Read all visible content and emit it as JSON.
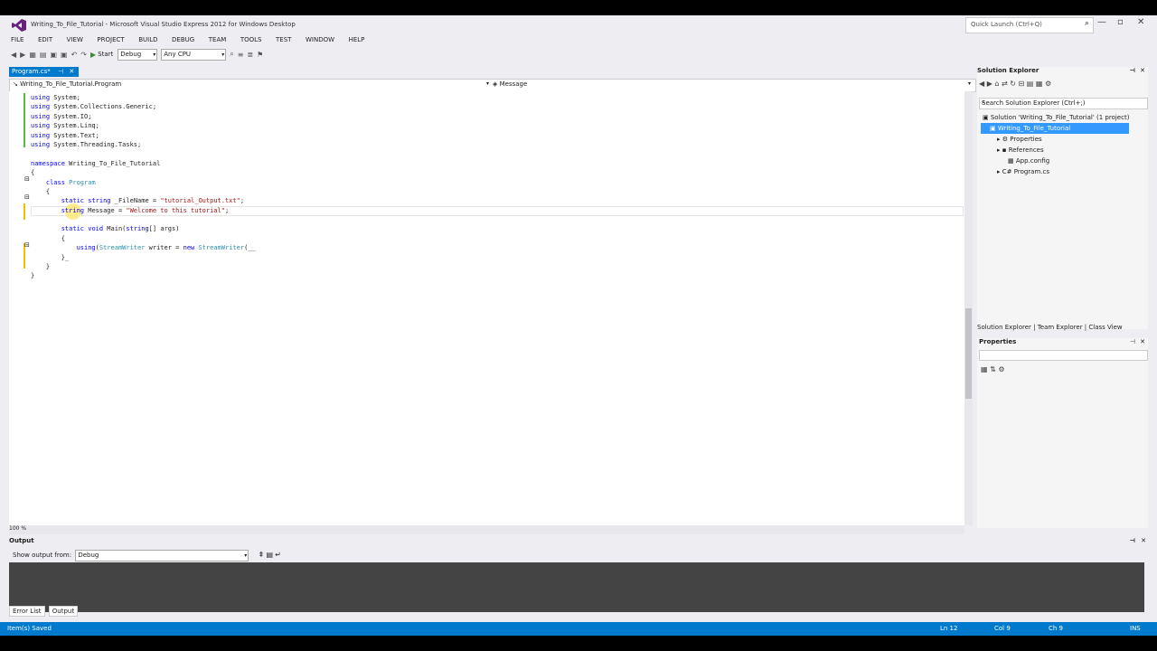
{
  "window": {
    "title": "Writing_To_File_Tutorial - Microsoft Visual Studio Express 2012 for Windows Desktop",
    "quick_launch_placeholder": "Quick Launch (Ctrl+Q)"
  },
  "menu": [
    "FILE",
    "EDIT",
    "VIEW",
    "PROJECT",
    "BUILD",
    "DEBUG",
    "TEAM",
    "TOOLS",
    "TEST",
    "WINDOW",
    "HELP"
  ],
  "toolbar": {
    "start_label": "Start",
    "config_value": "Debug",
    "platform_value": "Any CPU"
  },
  "doc_tab": {
    "label": "Program.cs*"
  },
  "navbar": {
    "left": "Writing_To_File_Tutorial.Program",
    "right": "Message"
  },
  "editor": {
    "lines": [
      [
        {
          "t": "using",
          "c": "kw"
        },
        {
          "t": " System;"
        }
      ],
      [
        {
          "t": "using",
          "c": "kw"
        },
        {
          "t": " System.Collections.Generic;"
        }
      ],
      [
        {
          "t": "using",
          "c": "kw"
        },
        {
          "t": " System.IO;"
        }
      ],
      [
        {
          "t": "using",
          "c": "kw"
        },
        {
          "t": " System.Linq;"
        }
      ],
      [
        {
          "t": "using",
          "c": "kw"
        },
        {
          "t": " System.Text;"
        }
      ],
      [
        {
          "t": "using",
          "c": "kw"
        },
        {
          "t": " System.Threading.Tasks;"
        }
      ],
      [],
      [
        {
          "t": "namespace",
          "c": "kw"
        },
        {
          "t": " Writing_To_File_Tutorial"
        }
      ],
      [
        {
          "t": "{"
        }
      ],
      [
        {
          "t": "    "
        },
        {
          "t": "class",
          "c": "kw"
        },
        {
          "t": " "
        },
        {
          "t": "Program",
          "c": "ty"
        }
      ],
      [
        {
          "t": "    {"
        }
      ],
      [
        {
          "t": "        "
        },
        {
          "t": "static",
          "c": "kw"
        },
        {
          "t": " "
        },
        {
          "t": "string",
          "c": "kw"
        },
        {
          "t": " _FileName = "
        },
        {
          "t": "\"tutorial_Output.txt\"",
          "c": "st"
        },
        {
          "t": ";"
        }
      ],
      [
        {
          "t": "        "
        },
        {
          "t": "string",
          "c": "kw"
        },
        {
          "t": " Message = "
        },
        {
          "t": "\"Welcome to this tutorial\"",
          "c": "st"
        },
        {
          "t": ";"
        }
      ],
      [],
      [
        {
          "t": "        "
        },
        {
          "t": "static",
          "c": "kw"
        },
        {
          "t": " "
        },
        {
          "t": "void",
          "c": "kw"
        },
        {
          "t": " Main("
        },
        {
          "t": "string",
          "c": "kw"
        },
        {
          "t": "[] args)"
        }
      ],
      [
        {
          "t": "        {"
        }
      ],
      [
        {
          "t": "            "
        },
        {
          "t": "using",
          "c": "kw"
        },
        {
          "t": "("
        },
        {
          "t": "StreamWriter",
          "c": "ty"
        },
        {
          "t": " writer = "
        },
        {
          "t": "new",
          "c": "kw"
        },
        {
          "t": " "
        },
        {
          "t": "StreamWriter",
          "c": "ty"
        },
        {
          "t": "(__"
        }
      ],
      [
        {
          "t": "        }_"
        }
      ],
      [
        {
          "t": "    }"
        }
      ],
      [
        {
          "t": "}"
        }
      ]
    ],
    "zoom": "100 %"
  },
  "solution_explorer": {
    "title": "Solution Explorer",
    "search_placeholder": "Search Solution Explorer (Ctrl+;)",
    "items": [
      "Solution 'Writing_To_File_Tutorial' (1 project)",
      "Writing_To_File_Tutorial",
      "Properties",
      "References",
      "App.config",
      "Program.cs"
    ]
  },
  "right_tabs": [
    "Solution Explorer",
    "Team Explorer",
    "Class View"
  ],
  "properties": {
    "title": "Properties"
  },
  "output": {
    "title": "Output",
    "source_label": "Show output from:",
    "source_value": "Debug"
  },
  "bottom_tabs": [
    "Error List",
    "Output"
  ],
  "status": {
    "message": "Item(s) Saved",
    "ln": "Ln 12",
    "col": "Col 9",
    "ch": "Ch 9",
    "mode": "INS"
  },
  "colors": {
    "accent": "#007acc",
    "keyword": "#0000ff",
    "string": "#a31515",
    "type": "#2b91af"
  }
}
